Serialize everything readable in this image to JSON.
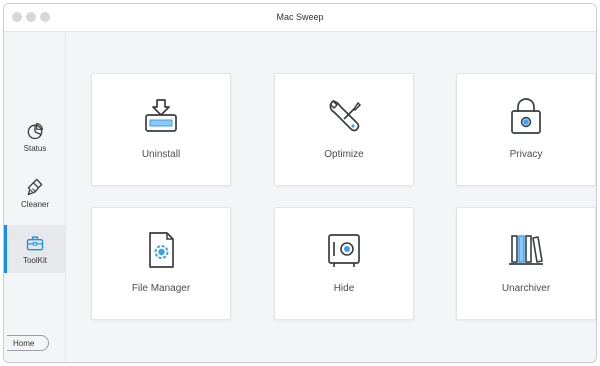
{
  "window": {
    "title": "Mac Sweep"
  },
  "sidebar": {
    "items": [
      {
        "label": "Status",
        "icon": "pie-chart-icon"
      },
      {
        "label": "Cleaner",
        "icon": "brush-icon"
      },
      {
        "label": "ToolKit",
        "icon": "toolbox-icon",
        "active": true
      }
    ],
    "home_label": "Home"
  },
  "tools": [
    {
      "label": "Uninstall",
      "icon": "uninstall-icon"
    },
    {
      "label": "Optimize",
      "icon": "wrench-icon"
    },
    {
      "label": "Privacy",
      "icon": "lock-icon"
    },
    {
      "label": "File Manager",
      "icon": "file-gear-icon"
    },
    {
      "label": "Hide",
      "icon": "safe-icon"
    },
    {
      "label": "Unarchiver",
      "icon": "books-icon"
    }
  ],
  "colors": {
    "accent": "#1a8cf0",
    "icon_stroke": "#3a3d44",
    "icon_blue": "#3aa0f0"
  }
}
